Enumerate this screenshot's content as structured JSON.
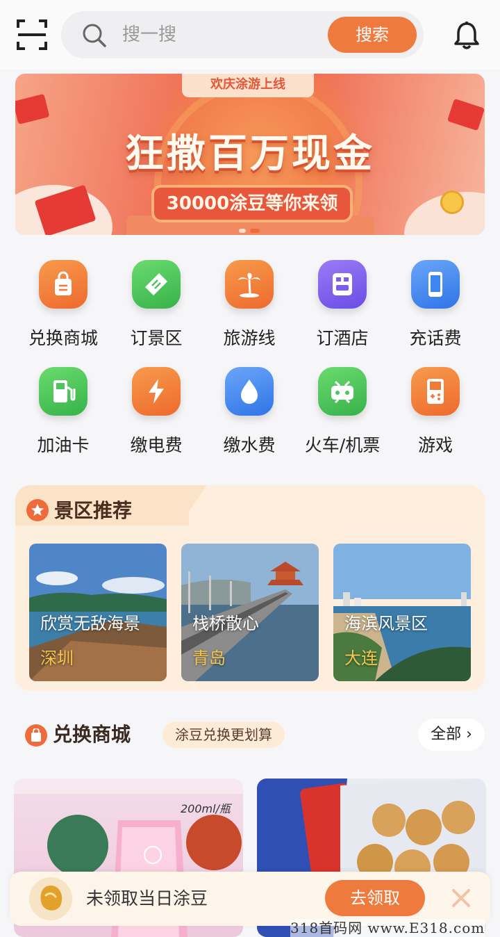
{
  "search": {
    "placeholder": "搜一搜",
    "button_label": "搜索"
  },
  "banner": {
    "tag": "欢庆涂游上线",
    "title": "狂撒百万现金",
    "subtitle": "30000涂豆等你来领",
    "slides": 2,
    "active_slide": 2
  },
  "grid": [
    {
      "label": "兑换商城",
      "icon": "shopping-bag-icon",
      "color": "#f07a3a"
    },
    {
      "label": "订景区",
      "icon": "ticket-icon",
      "color": "#4cc65c"
    },
    {
      "label": "旅游线",
      "icon": "palm-tree-icon",
      "color": "#f07a3a"
    },
    {
      "label": "订酒店",
      "icon": "hotel-icon",
      "color": "#7a5cf0"
    },
    {
      "label": "充话费",
      "icon": "phone-icon",
      "color": "#3f86f0"
    },
    {
      "label": "加油卡",
      "icon": "gas-pump-icon",
      "color": "#4cc65c"
    },
    {
      "label": "缴电费",
      "icon": "lightning-icon",
      "color": "#f07a3a"
    },
    {
      "label": "缴水费",
      "icon": "water-drop-icon",
      "color": "#3f86f0"
    },
    {
      "label": "火车/机票",
      "icon": "train-icon",
      "color": "#4cc65c"
    },
    {
      "label": "游戏",
      "icon": "gamepad-icon",
      "color": "#f07a3a"
    }
  ],
  "scenic": {
    "title": "景区推荐",
    "spots": [
      {
        "name": "欣赏无敌海景",
        "city": "深圳"
      },
      {
        "name": "栈桥散心",
        "city": "青岛"
      },
      {
        "name": "海滨风景区",
        "city": "大连"
      }
    ]
  },
  "mall": {
    "title": "兑换商城",
    "tag": "涂豆兑换更划算",
    "all_label": "全部",
    "products": [
      {
        "caption": "200ml/瓶"
      },
      {
        "caption": ""
      }
    ]
  },
  "toast": {
    "text": "未领取当日涂豆",
    "button_label": "去领取"
  },
  "watermark": "318首码网 www.E318.com",
  "colors": {
    "accent": "#ef7a3e",
    "scenic_bg": "#fdeedd"
  }
}
